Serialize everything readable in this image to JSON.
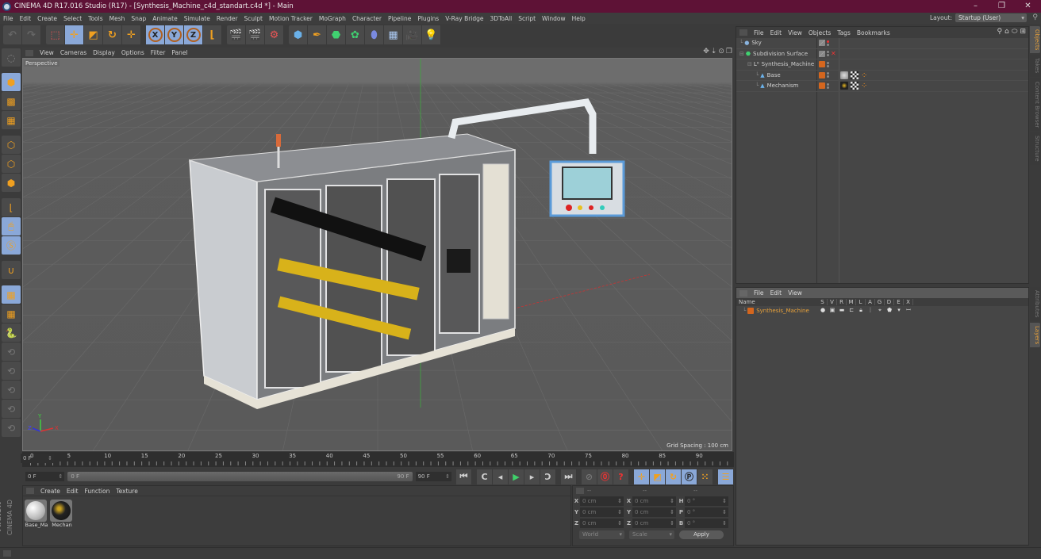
{
  "window": {
    "title": "CINEMA 4D R17.016 Studio (R17) - [Synthesis_Machine_c4d_standart.c4d *] - Main",
    "controls": [
      "minimize",
      "restore",
      "close"
    ]
  },
  "menubar": {
    "items": [
      "File",
      "Edit",
      "Create",
      "Select",
      "Tools",
      "Mesh",
      "Snap",
      "Animate",
      "Simulate",
      "Render",
      "Sculpt",
      "Motion Tracker",
      "MoGraph",
      "Character",
      "Pipeline",
      "Plugins",
      "V-Ray Bridge",
      "3DToAll",
      "Script",
      "Window",
      "Help"
    ],
    "layout_label": "Layout:",
    "layout_value": "Startup (User)"
  },
  "toolbar": {
    "groups": [
      {
        "name": "history",
        "buttons": [
          {
            "icon": "undo-icon",
            "active": false
          },
          {
            "icon": "redo-icon",
            "active": false
          }
        ]
      },
      {
        "name": "tools",
        "buttons": [
          {
            "icon": "live-selection-icon",
            "active": false
          },
          {
            "icon": "move-icon",
            "active": true
          },
          {
            "icon": "scale-icon",
            "active": false
          },
          {
            "icon": "rotate-icon",
            "active": false
          },
          {
            "icon": "recent-tool-icon",
            "active": false
          }
        ]
      },
      {
        "name": "axes",
        "buttons": [
          {
            "icon": "x-axis-icon",
            "label": "X",
            "active": true
          },
          {
            "icon": "y-axis-icon",
            "label": "Y",
            "active": true
          },
          {
            "icon": "z-axis-icon",
            "label": "Z",
            "active": true
          },
          {
            "icon": "coordinate-system-icon",
            "active": false
          }
        ]
      },
      {
        "name": "render",
        "buttons": [
          {
            "icon": "render-view-icon"
          },
          {
            "icon": "render-picture-viewer-icon"
          },
          {
            "icon": "render-settings-icon"
          }
        ]
      },
      {
        "name": "create",
        "buttons": [
          {
            "icon": "cube-icon"
          },
          {
            "icon": "pen-spline-icon"
          },
          {
            "icon": "subdivision-icon"
          },
          {
            "icon": "cloner-icon"
          },
          {
            "icon": "deformer-icon"
          },
          {
            "icon": "floor-icon"
          },
          {
            "icon": "camera-icon"
          },
          {
            "icon": "light-icon"
          }
        ]
      }
    ]
  },
  "leftbar": {
    "buttons": [
      {
        "icon": "make-editable-icon",
        "active": false
      },
      {
        "icon": "model-mode-icon",
        "active": true
      },
      {
        "icon": "texture-mode-icon",
        "active": false
      },
      {
        "icon": "workplane-mode-icon",
        "active": false
      },
      {
        "icon": "points-mode-icon",
        "active": false
      },
      {
        "icon": "edges-mode-icon",
        "active": false
      },
      {
        "icon": "polygons-mode-icon",
        "active": false
      },
      {
        "icon": "axis-mode-icon",
        "active": false
      },
      {
        "icon": "tweak-mode-icon",
        "active": true
      },
      {
        "icon": "solo-mode-icon",
        "active": true
      },
      {
        "icon": "snap-icon",
        "active": false
      },
      {
        "icon": "locked-workplane-icon",
        "active": true
      },
      {
        "icon": "planar-workplane-icon",
        "active": false
      },
      {
        "icon": "python-icon",
        "active": false
      },
      {
        "icon": "cache-icon",
        "active": false
      },
      {
        "icon": "ik-p-icon",
        "active": false
      },
      {
        "icon": "ik-r-icon",
        "active": false
      },
      {
        "icon": "ik-target-icon",
        "active": false
      },
      {
        "icon": "ik-edit-icon",
        "active": false
      }
    ]
  },
  "viewport": {
    "menu": [
      "View",
      "Cameras",
      "Display",
      "Options",
      "Filter",
      "Panel"
    ],
    "camera_label": "Perspective",
    "grid_spacing": "Grid Spacing : 100 cm",
    "axis_labels": {
      "x": "X",
      "y": "Y",
      "z": "Z"
    }
  },
  "timeline": {
    "ticks": [
      "0",
      "5",
      "10",
      "15",
      "20",
      "25",
      "30",
      "35",
      "40",
      "45",
      "50",
      "55",
      "60",
      "65",
      "70",
      "75",
      "80",
      "85",
      "90"
    ],
    "current_frame": "0 F"
  },
  "playback": {
    "start_field": "0 F",
    "slider_start": "0 F",
    "slider_end": "90 F",
    "end_field": "90 F",
    "buttons": [
      "go-to-start-icon",
      "previous-key-icon",
      "step-back-icon",
      "play-icon",
      "step-forward-icon",
      "next-key-icon",
      "go-to-end-icon",
      "motion-record-icon",
      "autokey-icon",
      "keyframe-selection-icon",
      "position-key-icon",
      "scale-key-icon",
      "rotation-key-icon",
      "parameter-key-icon",
      "point-level-icon",
      "timeline-icon"
    ]
  },
  "materials": {
    "menu": [
      "Create",
      "Edit",
      "Function",
      "Texture"
    ],
    "items": [
      {
        "label": "Base_Ma",
        "color": "#d8d8d8"
      },
      {
        "label": "Mechan",
        "color": "#2a2a2a"
      }
    ]
  },
  "brand": {
    "maxon": "MAXON",
    "product": "CINEMA 4D"
  },
  "coordinates": {
    "headers": [
      "--",
      "--",
      "--"
    ],
    "rows": [
      {
        "a1": "X",
        "v1": "0 cm",
        "a2": "X",
        "v2": "0 cm",
        "a3": "H",
        "v3": "0 °"
      },
      {
        "a1": "Y",
        "v1": "0 cm",
        "a2": "Y",
        "v2": "0 cm",
        "a3": "P",
        "v3": "0 °"
      },
      {
        "a1": "Z",
        "v1": "0 cm",
        "a2": "Z",
        "v2": "0 cm",
        "a3": "B",
        "v3": "0 °"
      }
    ],
    "space": "World",
    "mode": "Scale",
    "apply": "Apply"
  },
  "object_manager": {
    "menu": [
      "File",
      "Edit",
      "View",
      "Objects",
      "Tags",
      "Bookmarks"
    ],
    "objects": [
      {
        "name": "Sky",
        "icon": "sky-icon",
        "depth": 0,
        "swatch": "#777777",
        "tags": []
      },
      {
        "name": "Subdivision Surface",
        "icon": "subdivision-surface-icon",
        "depth": 0,
        "swatch": "#777777",
        "disabled": true,
        "tags": []
      },
      {
        "name": "Synthesis_Machine",
        "icon": "null-object-icon",
        "depth": 1,
        "swatch": "#d4661e",
        "tags": []
      },
      {
        "name": "Base",
        "icon": "polygon-object-icon",
        "depth": 2,
        "swatch": "#d4661e",
        "tags": [
          "material-tag",
          "texture-tag",
          "phong-tag"
        ]
      },
      {
        "name": "Mechanism",
        "icon": "polygon-object-icon",
        "depth": 2,
        "swatch": "#d4661e",
        "tags": [
          "material-tag",
          "texture-tag",
          "phong-tag"
        ]
      }
    ]
  },
  "side_tabs_top": [
    {
      "label": "Objects",
      "active": true
    },
    {
      "label": "Takes",
      "active": false
    },
    {
      "label": "Content Browser",
      "active": false
    },
    {
      "label": "Structure",
      "active": false
    }
  ],
  "side_tabs_bottom": [
    {
      "label": "Attributes",
      "active": false
    },
    {
      "label": "Layers",
      "active": true
    }
  ],
  "layer_manager": {
    "menu": [
      "File",
      "Edit",
      "View"
    ],
    "columns": {
      "name": "Name",
      "flags": [
        "S",
        "V",
        "R",
        "M",
        "L",
        "A",
        "G",
        "D",
        "E",
        "X"
      ]
    },
    "layers": [
      {
        "name": "Synthesis_Machine",
        "color": "#d4661e"
      }
    ]
  },
  "colors": {
    "titlebar": "#5e1236",
    "accent_orange": "#e8a13a",
    "active_blue": "#8aa8d8",
    "layer_orange": "#d4661e"
  }
}
